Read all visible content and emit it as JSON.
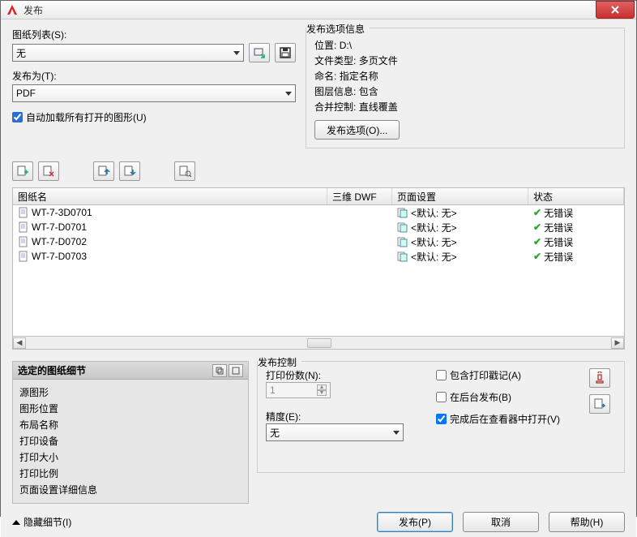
{
  "window": {
    "title": "发布"
  },
  "top_left": {
    "sheet_list_label": "图纸列表(S):",
    "sheet_list_value": "无",
    "publish_as_label": "发布为(T):",
    "publish_as_value": "PDF",
    "autoload_label": "自动加载所有打开的图形(U)",
    "autoload_checked": true
  },
  "pub_info": {
    "legend": "发布选项信息",
    "location_label": "位置:",
    "location_value": "D:\\",
    "filetype_label": "文件类型:",
    "filetype_value": "多页文件",
    "naming_label": "命名:",
    "naming_value": "指定名称",
    "layer_label": "图层信息:",
    "layer_value": "包含",
    "merge_label": "合并控制:",
    "merge_value": "直线覆盖",
    "options_btn": "发布选项(O)..."
  },
  "grid": {
    "headers": {
      "name": "图纸名",
      "dwf": "三维 DWF",
      "page": "页面设置",
      "status": "状态"
    },
    "rows": [
      {
        "name": "WT-7-3D0701",
        "page": "<默认: 无>",
        "status": "无错误"
      },
      {
        "name": "WT-7-D0701",
        "page": "<默认: 无>",
        "status": "无错误"
      },
      {
        "name": "WT-7-D0702",
        "page": "<默认: 无>",
        "status": "无错误"
      },
      {
        "name": "WT-7-D0703",
        "page": "<默认: 无>",
        "status": "无错误"
      }
    ]
  },
  "details": {
    "header": "选定的图纸细节",
    "lines": [
      "源图形",
      "图形位置",
      "布局名称",
      "打印设备",
      "打印大小",
      "打印比例",
      "页面设置详细信息"
    ]
  },
  "pubctrl": {
    "legend": "发布控制",
    "copies_label": "打印份数(N):",
    "copies_value": "1",
    "precision_label": "精度(E):",
    "precision_value": "无",
    "include_stamp": "包含打印戳记(A)",
    "background": "在后台发布(B)",
    "open_viewer": "完成后在查看器中打开(V)",
    "open_viewer_checked": true
  },
  "footer": {
    "hide_details": "隐藏细节(I)",
    "publish": "发布(P)",
    "cancel": "取消",
    "help": "帮助(H)"
  }
}
